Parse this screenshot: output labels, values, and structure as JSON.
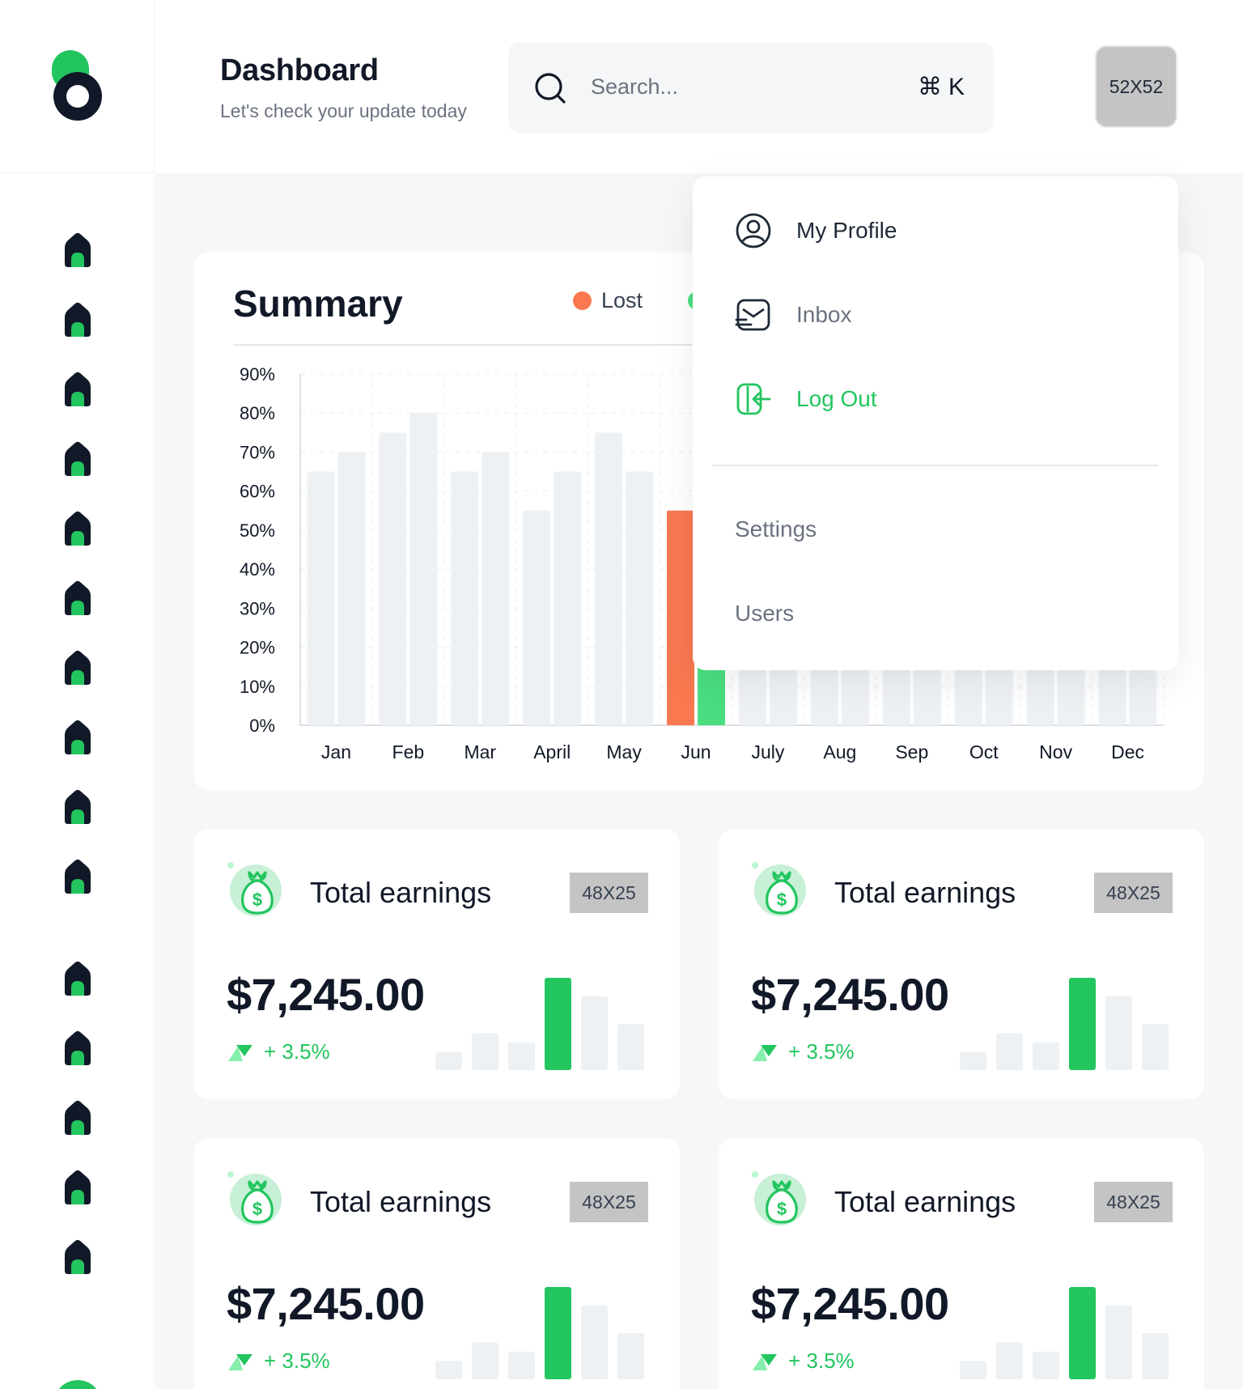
{
  "header": {
    "title": "Dashboard",
    "subtitle": "Let's check your update today",
    "search_placeholder": "Search...",
    "search_shortcut_key": "K",
    "avatar_label": "52X52"
  },
  "sidebar": {
    "nav_count": 15,
    "icon": "home-icon"
  },
  "summary": {
    "title": "Summary",
    "legend": [
      {
        "name": "Lost",
        "color": "#f97850"
      }
    ]
  },
  "chart_data": {
    "type": "bar",
    "categories": [
      "Jan",
      "Feb",
      "Mar",
      "April",
      "May",
      "Jun",
      "July",
      "Aug",
      "Sep",
      "Oct",
      "Nov",
      "Dec"
    ],
    "y_ticks": [
      "90%",
      "80%",
      "70%",
      "60%",
      "50%",
      "40%",
      "30%",
      "20%",
      "10%",
      "0%"
    ],
    "ylim": [
      0,
      90
    ],
    "series": [
      {
        "name": "Lost",
        "values": [
          65,
          75,
          65,
          55,
          75,
          55,
          null,
          null,
          null,
          null,
          null,
          null
        ]
      },
      {
        "name": "",
        "values": [
          70,
          80,
          70,
          65,
          65,
          15,
          null,
          null,
          null,
          null,
          null,
          null
        ]
      }
    ],
    "highlight_category": "Jun",
    "colors": {
      "highlight_a": "#f97850",
      "highlight_b": "#4ade80",
      "muted": "#eef1f4"
    },
    "grid": true
  },
  "dropdown": {
    "items": [
      {
        "label": "My Profile",
        "icon": "user-circle-icon",
        "color": "#1f2937"
      },
      {
        "label": "Inbox",
        "icon": "inbox-icon",
        "color": "#6b7280"
      },
      {
        "label": "Log Out",
        "icon": "logout-icon",
        "color": "#22c55e"
      }
    ],
    "links": [
      {
        "label": "Settings"
      },
      {
        "label": "Users"
      }
    ]
  },
  "earnings": [
    {
      "title": "Total earnings",
      "badge": "48X25",
      "value": "$7,245.00",
      "change": "+ 3.5%",
      "bars": [
        20,
        40,
        30,
        100,
        80,
        50
      ]
    },
    {
      "title": "Total earnings",
      "badge": "48X25",
      "value": "$7,245.00",
      "change": "+ 3.5%",
      "bars": [
        20,
        40,
        30,
        100,
        80,
        50
      ]
    },
    {
      "title": "Total earnings",
      "badge": "48X25",
      "value": "$7,245.00",
      "change": "+ 3.5%",
      "bars": [
        20,
        40,
        30,
        100,
        80,
        50
      ]
    },
    {
      "title": "Total earnings",
      "badge": "48X25",
      "value": "$7,245.00",
      "change": "+ 3.5%",
      "bars": [
        20,
        40,
        30,
        100,
        80,
        50
      ]
    }
  ],
  "colors": {
    "brand_green": "#22c55e",
    "accent_orange": "#f97850",
    "dark": "#111827"
  }
}
